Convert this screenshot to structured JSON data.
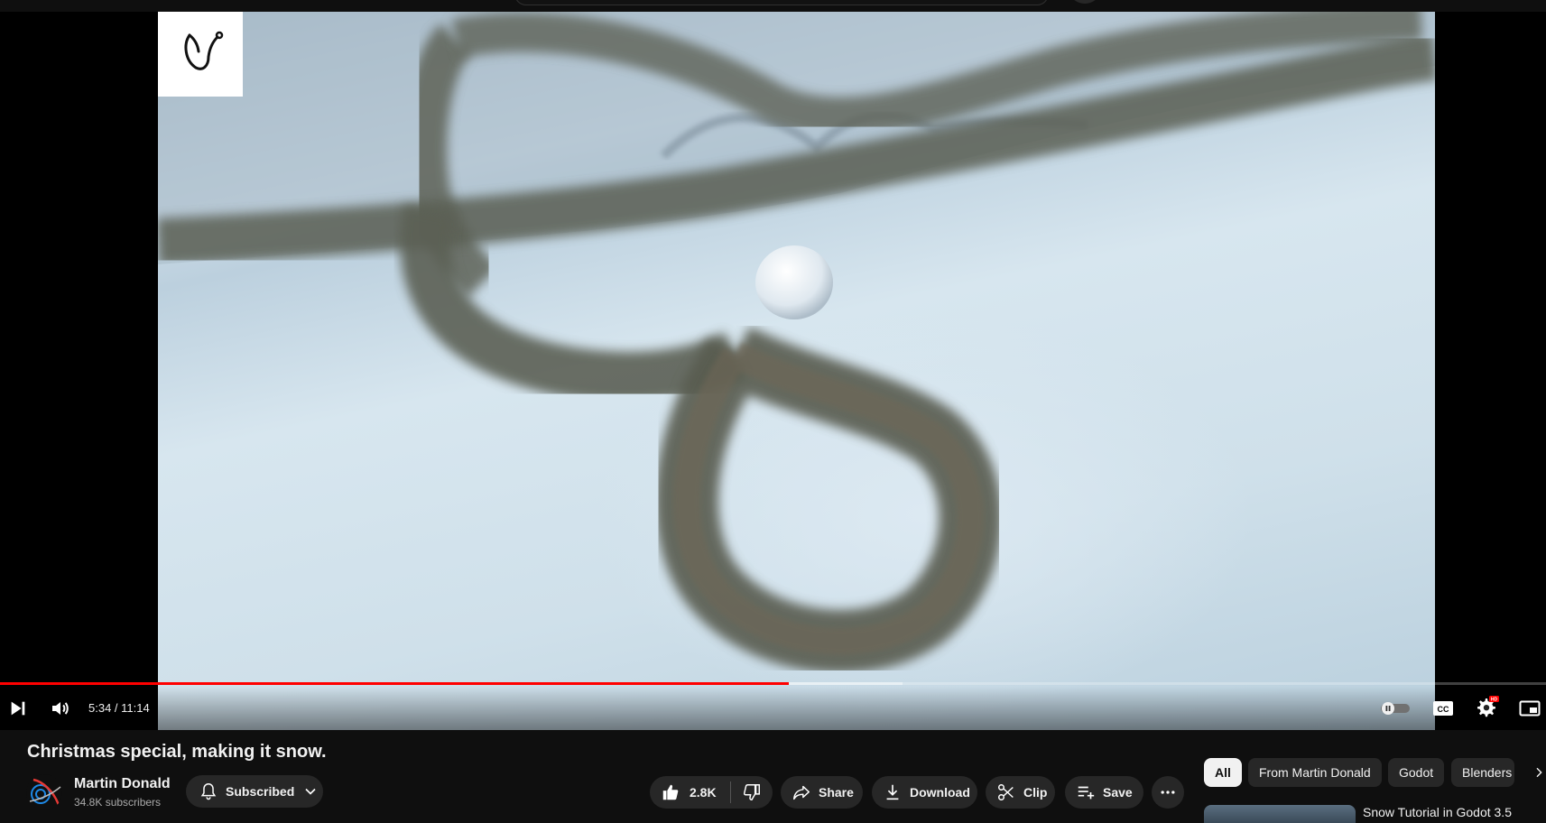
{
  "video": {
    "title": "Christmas special, making it snow.",
    "current_time": "5:34",
    "duration": "11:14",
    "time_separator": " / ",
    "progress_fraction": 0.51,
    "buffered_fraction": 0.584
  },
  "channel": {
    "name": "Martin Donald",
    "subscribers": "34.8K subscribers",
    "subscribe_label": "Subscribed"
  },
  "actions": {
    "likes": "2.8K",
    "share_label": "Share",
    "download_label": "Download",
    "clip_label": "Clip",
    "save_label": "Save"
  },
  "player_icons": [
    "play-next-icon",
    "volume-icon",
    "autoplay-toggle-icon",
    "captions-icon",
    "settings-icon",
    "miniplayer-icon"
  ],
  "settings_badge": "HD",
  "captions_label": "CC",
  "chips": [
    {
      "label": "All",
      "active": true
    },
    {
      "label": "From Martin Donald",
      "active": false
    },
    {
      "label": "Godot",
      "active": false
    },
    {
      "label": "Blenders",
      "active": false
    }
  ],
  "recommended": {
    "first_title": "Snow Tutorial in Godot 3.5"
  },
  "colors": {
    "accent": "#ff0000",
    "background": "#0f0f0f",
    "pill": "#272727"
  }
}
